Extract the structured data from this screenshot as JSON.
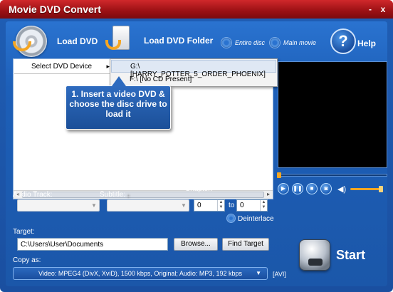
{
  "window": {
    "title": "Movie DVD Convert",
    "minimize": "-",
    "close": "x"
  },
  "toolbar": {
    "load_dvd": "Load DVD",
    "load_dvd_folder": "Load DVD Folder",
    "entire_disc": "Entire disc",
    "main_movie": "Main movie",
    "help": "Help",
    "help_glyph": "?"
  },
  "menu": {
    "select_device": "Select DVD Device",
    "arrow": "▸",
    "items": [
      "G:\\ [HARRY_POTTER_5_ORDER_PHOENIX]",
      "F:\\ [No CD Present]"
    ]
  },
  "callout": {
    "text": "1. Insert a video DVD & choose the disc drive to load it"
  },
  "scroll": {
    "left": "◂",
    "right": "▸",
    "grip": "⦙⦙⦙"
  },
  "player": {
    "play": "▶",
    "pause": "❚❚",
    "stop": "■",
    "snapshot": "◙",
    "volume": "◀)",
    "position_fraction": 0.0,
    "volume_fraction": 1.0
  },
  "fields": {
    "audio_track_label": "Audio Track:",
    "subtitle_label": "Subtitle:",
    "chapter_label": "Chapter:",
    "chapter_from": "0",
    "chapter_to_label": "to",
    "chapter_to": "0",
    "deinterlace": "Deinterlace",
    "target_label": "Target:",
    "target_value": "C:\\Users\\User\\Documents",
    "browse": "Browse...",
    "find_target": "Find Target",
    "copy_as_label": "Copy as:",
    "copy_as_value": "Video: MPEG4 (DivX, XviD), 1500 kbps, Original; Audio: MP3, 192 kbps",
    "extension": "[AVI]",
    "start": "Start"
  },
  "colors": {
    "accent": "#1d5fb8",
    "titlebar": "#b3161b",
    "highlight": "#f5a623"
  }
}
